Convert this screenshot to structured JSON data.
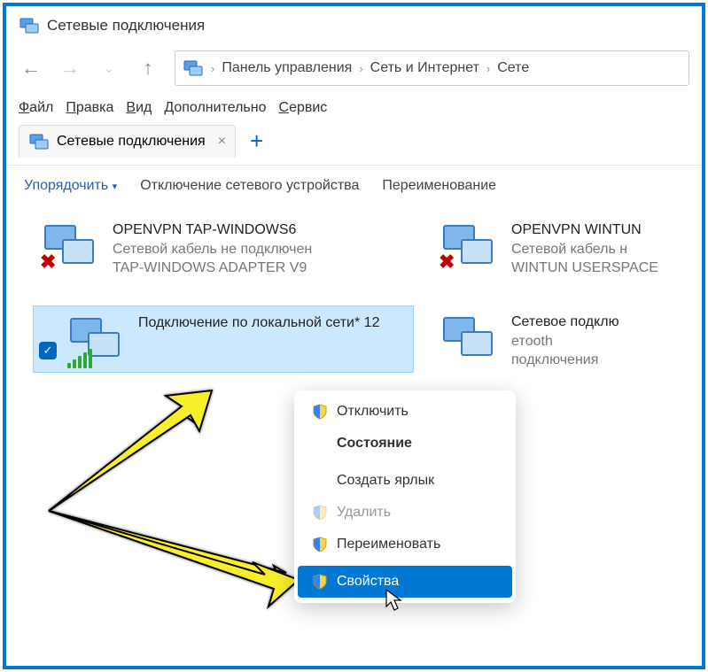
{
  "window": {
    "title": "Сетевые подключения"
  },
  "breadcrumb": {
    "parts": [
      "Панель управления",
      "Сеть и Интернет",
      "Сете"
    ]
  },
  "menu": {
    "file": "Файл",
    "edit": "Правка",
    "view": "Вид",
    "extra": "Дополнительно",
    "service": "Сервис"
  },
  "tab": {
    "label": "Сетевые подключения"
  },
  "toolbar": {
    "sort": "Упорядочить",
    "disable": "Отключение сетевого устройства",
    "rename": "Переименование"
  },
  "adapters": [
    {
      "name": "OPENVPN TAP-WINDOWS6",
      "status": "Сетевой кабель не подключен",
      "detail": "TAP-WINDOWS ADAPTER V9"
    },
    {
      "name": "OPENVPN WINTUN",
      "status": "Сетевой кабель н",
      "detail": "WINTUN USERSPACE"
    },
    {
      "name": "Подключение по локальной сети* 12",
      "status": "",
      "detail": ""
    },
    {
      "name": "Сетевое подклю",
      "status": "етooth",
      "detail": "подключения"
    }
  ],
  "ctx": {
    "disable": "Отключить",
    "status": "Состояние",
    "shortcut": "Создать ярлык",
    "delete": "Удалить",
    "rename": "Переименовать",
    "props": "Свойства"
  }
}
